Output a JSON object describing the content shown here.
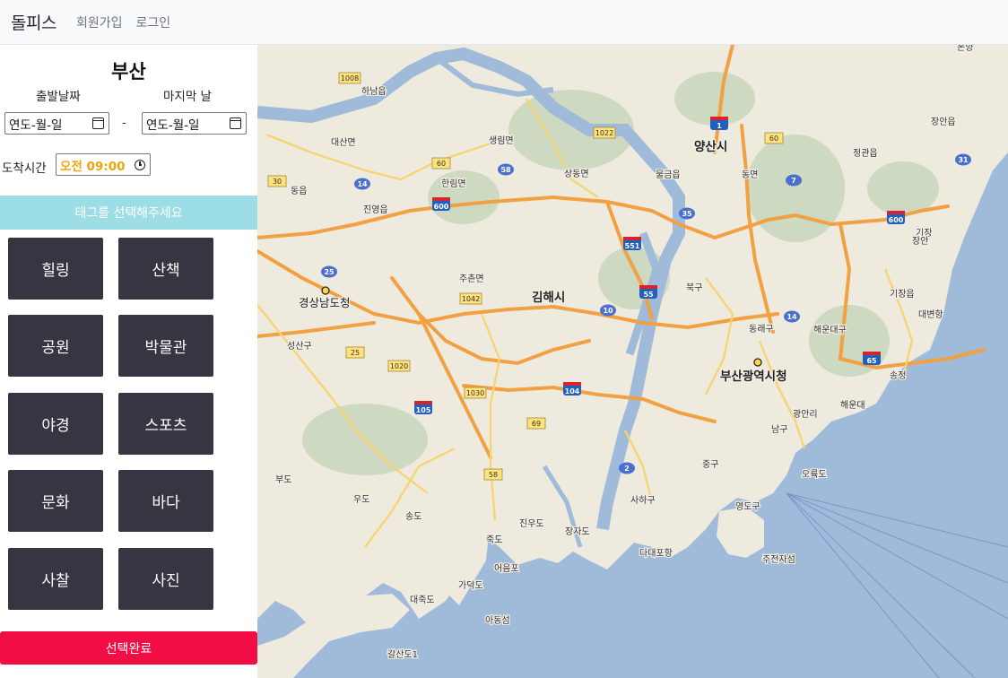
{
  "navbar": {
    "brand": "돌피스",
    "links": [
      "회원가입",
      "로그인"
    ]
  },
  "sidebar": {
    "city": "부산",
    "start_label": "출발날짜",
    "end_label": "마지막 날",
    "start_date_value": "연도-월-일",
    "end_date_value": "연도-월-일",
    "date_separator": "-",
    "arrive_label": "도착시간",
    "arrive_time_value": "오전 09:00",
    "tag_prompt": "태그를 선택해주세요",
    "tags": [
      "힐링",
      "산책",
      "공원",
      "박물관",
      "야경",
      "스포츠",
      "문화",
      "바다",
      "사찰",
      "사진"
    ],
    "submit_label": "선택완료"
  },
  "map": {
    "labels": {
      "main_city": "부산광역시청",
      "gimhae": "김해시",
      "yangsan": "양산시",
      "gyeongnam": "경상남도청",
      "haeundae_gu": "해운대구",
      "dongnae": "동래구",
      "buk": "북구",
      "saha": "사하구",
      "yeongdo": "영도구",
      "nam": "남구",
      "jung": "중구",
      "haeundae": "해운대",
      "gijang": "기장읍",
      "gijang2": "기장",
      "jeonggwan": "정관읍",
      "jangan": "장안읍",
      "mulgeum": "물금읍",
      "dongmyeon": "동면",
      "saengnim": "생림면",
      "sangdong": "상동면",
      "hallim": "한림면",
      "jinyeong": "진영읍",
      "jusan": "주촌면",
      "seongsan": "성산구",
      "daesan": "대산면",
      "hanam": "하남읍",
      "dong": "동읍",
      "gadeokdo": "가덕도",
      "songdo": "송도",
      "jukdo": "죽도",
      "dadaepo": "다대포항",
      "ulsan": "온양",
      "jujeon": "주전자섬",
      "orukdo": "오륙도",
      "gwangalli": "광안리",
      "uodo": "우도",
      "budo": "부도",
      "daejukdo": "대죽도",
      "eoeumpo": "어음포",
      "galsando": "갈산도1",
      "adongseom": "아동섬",
      "jangjado": "장자도",
      "jinudo": "진우도",
      "ilgwang": "일광",
      "jangan2": "장안",
      "songjeong": "송정",
      "daebyeon": "대변항"
    },
    "shields": {
      "exp_600": "600",
      "exp_551": "551",
      "exp_55": "55",
      "exp_104": "104",
      "exp_105": "105",
      "exp_65": "65",
      "exp_1": "1",
      "nat_7": "7",
      "nat_14": "14",
      "nat_35": "35",
      "nat_58": "58",
      "nat_25": "25",
      "nat_10": "10",
      "nat_2": "2",
      "nat_31": "31",
      "loc_1008": "1008",
      "loc_1022": "1022",
      "loc_60": "60",
      "loc_30": "30",
      "loc_1042": "1042",
      "loc_1020": "1020",
      "loc_1030": "1030",
      "loc_69": "69",
      "loc_58b": "58",
      "loc_25b": "25"
    }
  }
}
